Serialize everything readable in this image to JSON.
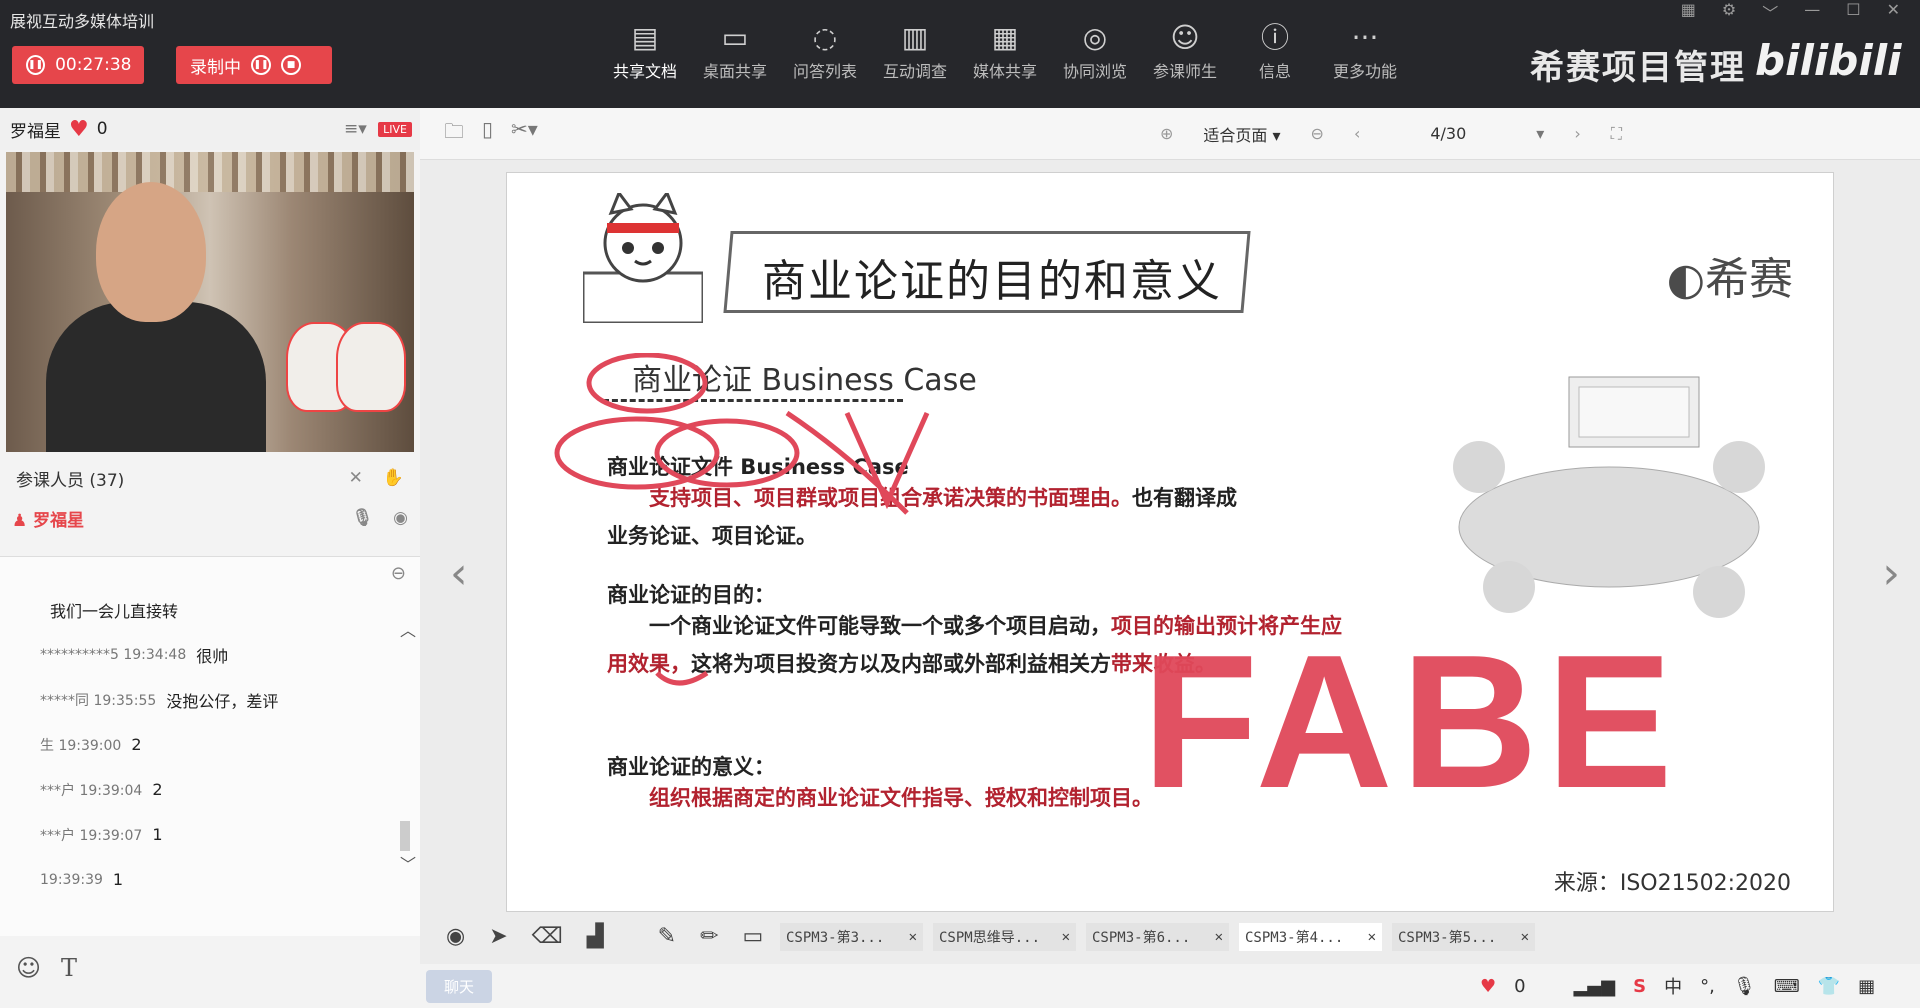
{
  "app": {
    "title": "展视互动多媒体培训"
  },
  "session": {
    "timer": "00:27:38",
    "recording_label": "录制中"
  },
  "toolbar": {
    "items": [
      {
        "label": "共享文档",
        "icon": "document-icon"
      },
      {
        "label": "桌面共享",
        "icon": "monitor-icon"
      },
      {
        "label": "问答列表",
        "icon": "chat-bubble-icon"
      },
      {
        "label": "互动调查",
        "icon": "bar-chart-icon"
      },
      {
        "label": "媒体共享",
        "icon": "film-icon"
      },
      {
        "label": "协同浏览",
        "icon": "compass-icon"
      },
      {
        "label": "参课师生",
        "icon": "users-icon"
      },
      {
        "label": "信息",
        "icon": "info-icon"
      },
      {
        "label": "更多功能",
        "icon": "more-icon"
      }
    ]
  },
  "brand": {
    "name": "希赛项目管理",
    "bili": "bilibili"
  },
  "presenter": {
    "name": "罗福星",
    "likes": "0",
    "live_badge": "LIVE"
  },
  "participants": {
    "label": "参课人员 (37)",
    "host_name": "罗福星"
  },
  "chat": {
    "messages": [
      {
        "meta": "",
        "text": "我们一会儿直接转"
      },
      {
        "meta": "**********5 19:34:48",
        "text": "很帅"
      },
      {
        "meta": "*****同 19:35:55",
        "text": "没抱公仔，差评"
      },
      {
        "meta": "生 19:39:00",
        "text": "2"
      },
      {
        "meta": "***户 19:39:04",
        "text": "2"
      },
      {
        "meta": "***户 19:39:07",
        "text": "1"
      },
      {
        "meta": "19:39:39",
        "text": "1"
      }
    ]
  },
  "doc_toolbar": {
    "zoom": "适合页面",
    "page": "4/30"
  },
  "slide": {
    "title": "商业论证的目的和意义",
    "logo": "希赛",
    "subtitle": "商业论证 Business Case",
    "sec1": "商业论证文件 Business Case",
    "p1a": "支持项目、项目群或项目组合承诺决策的书面理由。",
    "p1b": "也有翻译成",
    "p1c": "业务论证、项目论证。",
    "sec2": "商业论证的目的：",
    "p2a": "一个商业论证文件可能导致一个或多个项目启动，",
    "p2b": "项目的输出预计将产生应用效果，",
    "p2c": "这将为项目投资方以及内部或外部利益相关方",
    "p2d": "带来收益。",
    "sec3": "商业论证的意义：",
    "p3": "组织根据商定的商业论证文件指导、授权和控制项目。",
    "source": "来源：ISO21502:2020",
    "annotation": "FABE"
  },
  "doc_tabs": [
    "CSPM3-第3...",
    "CSPM思维导...",
    "CSPM3-第6...",
    "CSPM3-第4...",
    "CSPM3-第5..."
  ],
  "status": {
    "chat_button": "聊天",
    "likes": "0",
    "ime": "中"
  }
}
